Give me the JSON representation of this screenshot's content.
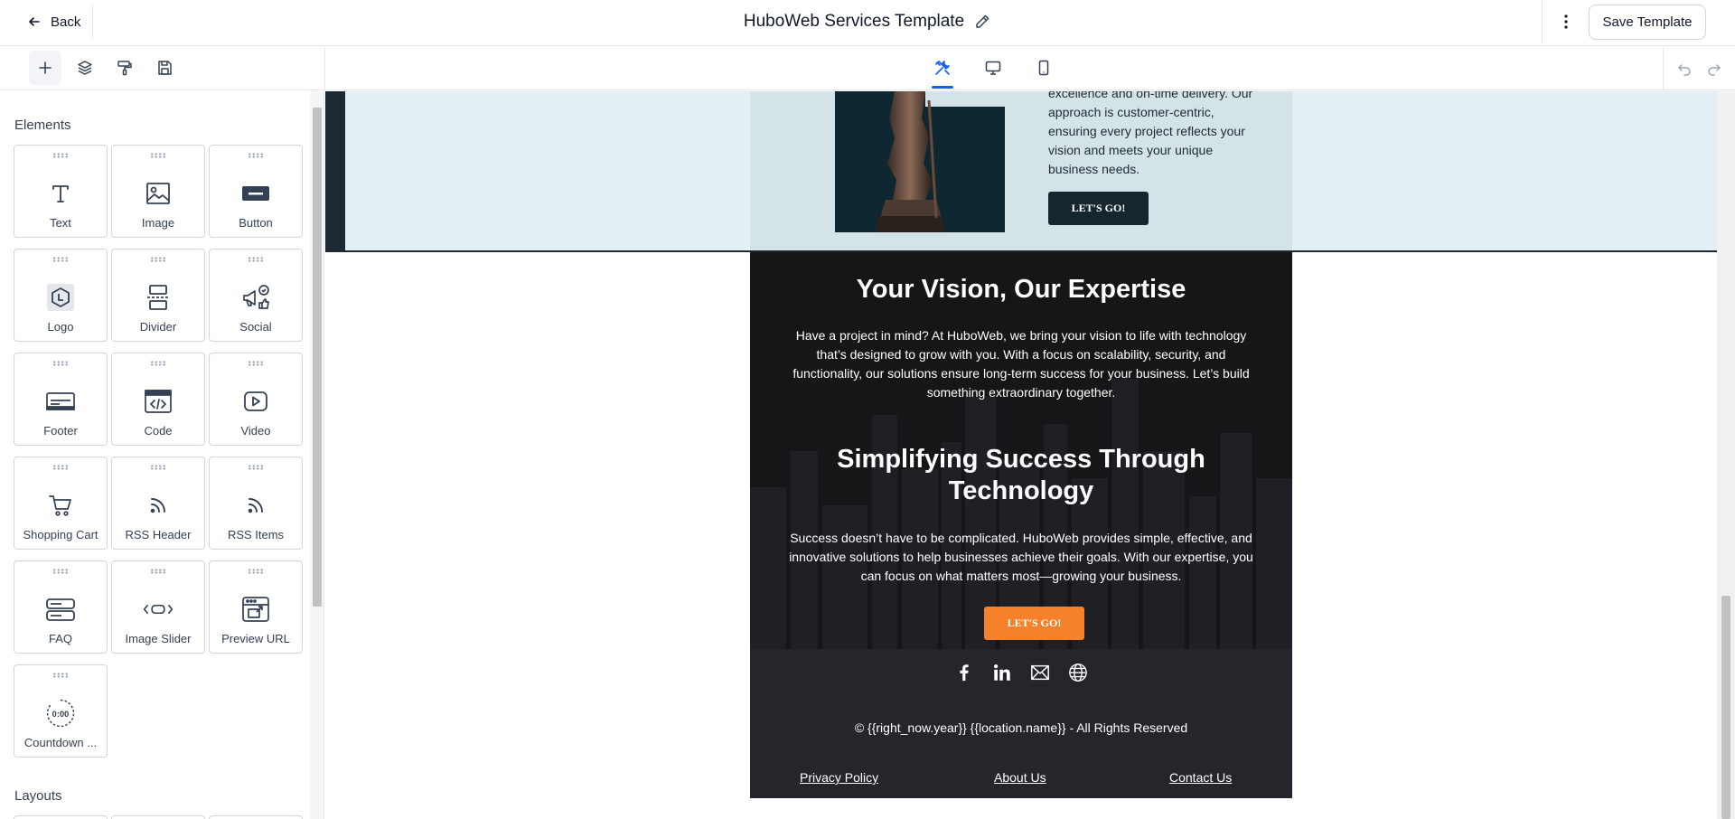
{
  "topbar": {
    "back_label": "Back",
    "title": "HuboWeb Services Template",
    "save_label": "Save Template"
  },
  "sidebar": {
    "elements_title": "Elements",
    "layouts_title": "Layouts",
    "tiles": [
      {
        "label": "Text",
        "icon": "text-icon"
      },
      {
        "label": "Image",
        "icon": "image-icon"
      },
      {
        "label": "Button",
        "icon": "button-icon"
      },
      {
        "label": "Logo",
        "icon": "logo-icon"
      },
      {
        "label": "Divider",
        "icon": "divider-icon"
      },
      {
        "label": "Social",
        "icon": "social-icon"
      },
      {
        "label": "Footer",
        "icon": "footer-icon"
      },
      {
        "label": "Code",
        "icon": "code-icon"
      },
      {
        "label": "Video",
        "icon": "video-icon"
      },
      {
        "label": "Shopping Cart",
        "icon": "cart-icon"
      },
      {
        "label": "RSS Header",
        "icon": "rss-icon"
      },
      {
        "label": "RSS Items",
        "icon": "rss-icon"
      },
      {
        "label": "FAQ",
        "icon": "faq-icon"
      },
      {
        "label": "Image Slider",
        "icon": "slider-icon"
      },
      {
        "label": "Preview URL",
        "icon": "preview-url-icon"
      },
      {
        "label": "Countdown ...",
        "icon": "countdown-icon"
      }
    ]
  },
  "canvas": {
    "hero_text": "excellence and on-time delivery. Our approach is customer-centric, ensuring every project reflects your vision and meets your unique business needs.",
    "hero_button": "LET'S GO!",
    "heading_1": "Your Vision, Our Expertise",
    "para_1": "Have a project in mind? At HuboWeb, we bring your vision to life with technology that’s designed to grow with you. With a focus on scalability, security, and functionality, our solutions ensure long-term success for your business. Let’s build something extraordinary together.",
    "heading_2": "Simplifying Success Through Technology",
    "para_2": "Success doesn’t have to be complicated. HuboWeb provides simple, effective, and innovative solutions to help businesses achieve their goals. With our expertise, you can focus on what matters most—growing your business.",
    "cta_button": "LET'S GO!",
    "copyright": "© {{right_now.year}}  {{location.name}} - All Rights Reserved",
    "links": {
      "privacy": "Privacy Policy",
      "about": "About Us",
      "contact": "Contact Us"
    }
  },
  "colors": {
    "accent": "#155eef",
    "cta_orange": "#f5822a",
    "dark_bg": "#161619",
    "footer_bg": "#24262b"
  }
}
